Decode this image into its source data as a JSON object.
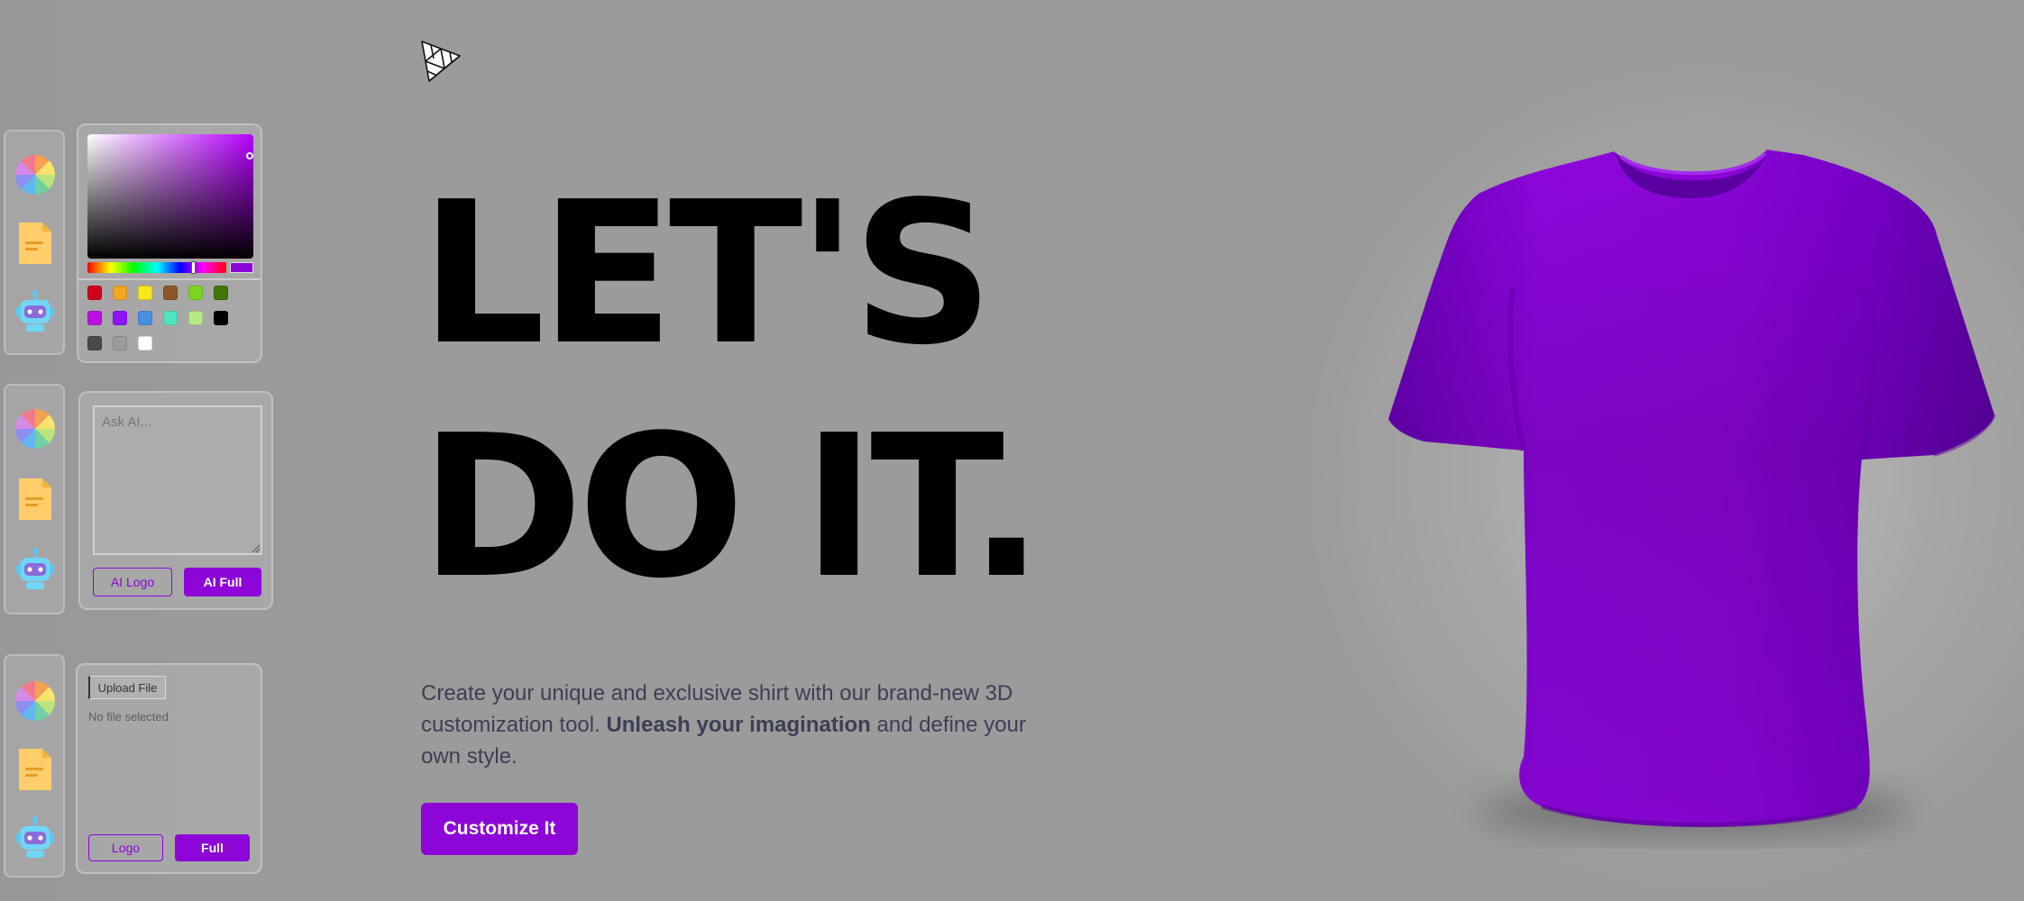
{
  "app": {
    "logo": "threejs-triangle-logo"
  },
  "toolbars": [
    {
      "tools": [
        {
          "name": "color-picker-tab",
          "icon": "color-wheel-icon"
        },
        {
          "name": "file-picker-tab",
          "icon": "file-icon"
        },
        {
          "name": "ai-picker-tab",
          "icon": "robot-icon"
        }
      ]
    },
    {
      "tools": [
        {
          "name": "color-picker-tab",
          "icon": "color-wheel-icon"
        },
        {
          "name": "file-picker-tab",
          "icon": "file-icon"
        },
        {
          "name": "ai-picker-tab",
          "icon": "robot-icon"
        }
      ]
    },
    {
      "tools": [
        {
          "name": "color-picker-tab",
          "icon": "color-wheel-icon"
        },
        {
          "name": "file-picker-tab",
          "icon": "file-icon"
        },
        {
          "name": "ai-picker-tab",
          "icon": "robot-icon"
        }
      ]
    }
  ],
  "color_picker": {
    "selected_color": "#8a05d6",
    "hue_position": 0.76,
    "swatches": [
      "#d0021b",
      "#f5a623",
      "#f8e71c",
      "#8b572a",
      "#7ed321",
      "#417505",
      "#bd10e0",
      "#9013fe",
      "#4a90e2",
      "#50e3c2",
      "#b8e986",
      "#000000",
      "#4a4a4a",
      "#9b9b9b",
      "#ffffff"
    ]
  },
  "ai_picker": {
    "prompt_placeholder": "Ask AI...",
    "prompt_value": "",
    "logo_button": "AI Logo",
    "full_button": "AI Full"
  },
  "file_picker": {
    "upload_label": "Upload File",
    "status": "No file selected",
    "logo_button": "Logo",
    "full_button": "Full"
  },
  "hero": {
    "headline_line1": "LET'S",
    "headline_line2": "DO IT.",
    "description_part1": "Create your unique and exclusive shirt with our brand-new 3D customization tool. ",
    "description_bold": "Unleash your imagination",
    "description_part2": " and define your own style.",
    "cta_label": "Customize It"
  },
  "colors": {
    "accent": "#8d05d7",
    "shirt": "#8a05d6",
    "background": "#9b9b9b"
  }
}
